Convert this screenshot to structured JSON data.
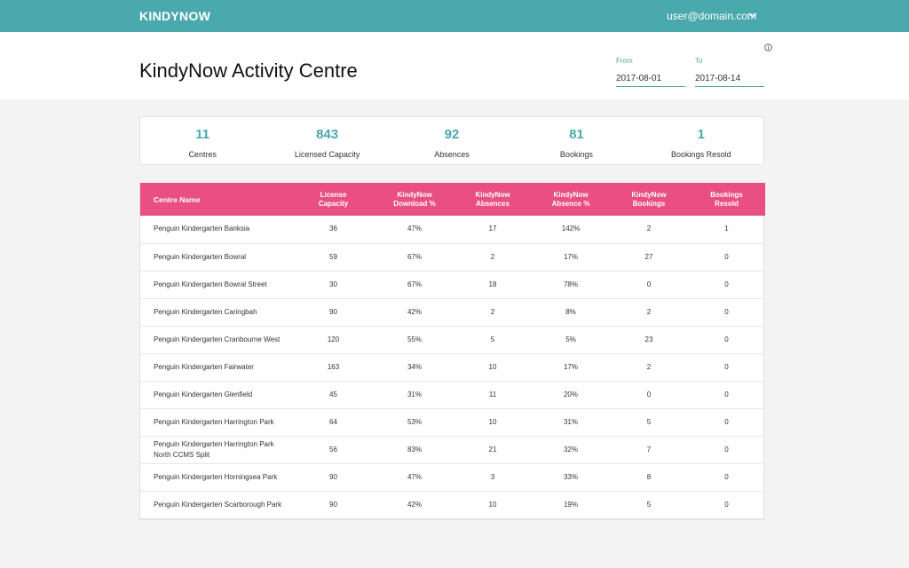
{
  "topbar": {
    "brand": "KINDYNOW",
    "user": "user@domain.com",
    "user_menu_icon": "chevron-down-icon"
  },
  "header": {
    "title": "KindyNow Activity Centre",
    "info_icon": "info-icon",
    "from": {
      "label": "From",
      "value": "2017-08-01"
    },
    "to": {
      "label": "To",
      "value": "2017-08-14"
    }
  },
  "stats": [
    {
      "value": "11",
      "label": "Centres"
    },
    {
      "value": "843",
      "label": "Licensed Capacity"
    },
    {
      "value": "92",
      "label": "Absences"
    },
    {
      "value": "81",
      "label": "Bookings"
    },
    {
      "value": "1",
      "label": "Bookings Resold"
    }
  ],
  "table": {
    "headers": [
      [
        "Centre Name"
      ],
      [
        "License",
        "Capacity"
      ],
      [
        "KindyNow",
        "Download %"
      ],
      [
        "KindyNow",
        "Absences"
      ],
      [
        "KindyNow",
        "Absence %"
      ],
      [
        "KindyNow",
        "Bookings"
      ],
      [
        "Bookings",
        "Resold"
      ]
    ],
    "rows": [
      [
        "Penguin Kindergarten Banksia",
        "36",
        "47%",
        "17",
        "142%",
        "2",
        "1"
      ],
      [
        "Penguin Kindergarten Bowral",
        "59",
        "67%",
        "2",
        "17%",
        "27",
        "0"
      ],
      [
        "Penguin Kindergarten Bowral Street",
        "30",
        "67%",
        "18",
        "78%",
        "0",
        "0"
      ],
      [
        "Penguin Kindergarten Caringbah",
        "90",
        "42%",
        "2",
        "8%",
        "2",
        "0"
      ],
      [
        "Penguin Kindergarten Cranbourne West",
        "120",
        "55%",
        "5",
        "5%",
        "23",
        "0"
      ],
      [
        "Penguin Kindergarten Fairwater",
        "163",
        "34%",
        "10",
        "17%",
        "2",
        "0"
      ],
      [
        "Penguin Kindergarten Glenfield",
        "45",
        "31%",
        "11",
        "20%",
        "0",
        "0"
      ],
      [
        "Penguin Kindergarten Harrington Park",
        "64",
        "53%",
        "10",
        "31%",
        "5",
        "0"
      ],
      [
        "Penguin Kindergarten Harrington Park North CCMS Split",
        "56",
        "83%",
        "21",
        "32%",
        "7",
        "0"
      ],
      [
        "Penguin Kindergarten Horningsea Park",
        "90",
        "47%",
        "3",
        "33%",
        "8",
        "0"
      ],
      [
        "Penguin Kindergarten Scarborough Park",
        "90",
        "42%",
        "10",
        "19%",
        "5",
        "0"
      ]
    ]
  },
  "colors": {
    "teal": "#4aa9ad",
    "pink": "#e94f82",
    "background": "#f3f3f3"
  }
}
